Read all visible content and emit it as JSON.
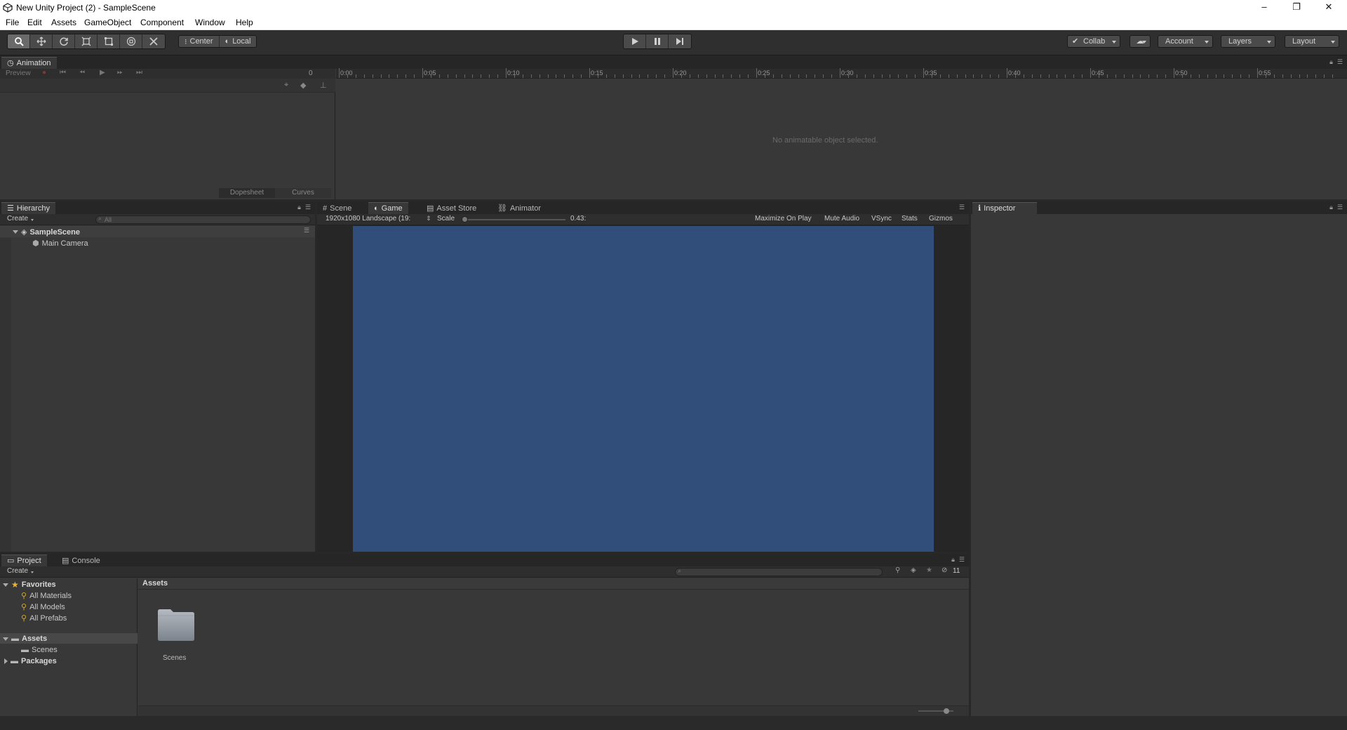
{
  "window": {
    "title": "New Unity Project (2) - SampleScene",
    "controls": {
      "minimize": "–",
      "maximize": "❐",
      "close": "✕"
    }
  },
  "menu": [
    "File",
    "Edit",
    "Assets",
    "GameObject",
    "Component",
    "Window",
    "Help"
  ],
  "toolbar": {
    "pivot_label": "Center",
    "space_label": "Local",
    "collab_label": "Collab",
    "account_label": "Account",
    "layers_label": "Layers",
    "layout_label": "Layout"
  },
  "animation": {
    "tab_label": "Animation",
    "preview_label": "Preview",
    "frame_value": "0",
    "time_labels": [
      "0:00",
      "0:05",
      "0:10",
      "0:15",
      "0:20",
      "0:25",
      "0:30",
      "0:35",
      "0:40",
      "0:45",
      "0:50",
      "0:55"
    ],
    "empty_message": "No animatable object selected.",
    "dopesheet_label": "Dopesheet",
    "curves_label": "Curves"
  },
  "hierarchy": {
    "tab_label": "Hierarchy",
    "create_label": "Create",
    "search_placeholder": "All",
    "scene_name": "SampleScene",
    "objects": [
      "Main Camera"
    ]
  },
  "game_view": {
    "tabs": [
      "Scene",
      "Game",
      "Asset Store",
      "Animator"
    ],
    "resolution": "1920x1080 Landscape (19:",
    "scale_label": "Scale",
    "scale_value": "0.43:",
    "maximize_label": "Maximize On Play",
    "mute_label": "Mute Audio",
    "vsync_label": "VSync",
    "stats_label": "Stats",
    "gizmos_label": "Gizmos",
    "background_color": "#314D79"
  },
  "inspector": {
    "tab_label": "Inspector"
  },
  "project": {
    "tabs": [
      "Project",
      "Console"
    ],
    "create_label": "Create",
    "hidden_count": "11",
    "favorites_label": "Favorites",
    "favorites": [
      "All Materials",
      "All Models",
      "All Prefabs"
    ],
    "assets_label": "Assets",
    "asset_children": [
      "Scenes"
    ],
    "packages_label": "Packages",
    "breadcrumb": "Assets",
    "grid_items": [
      "Scenes"
    ]
  }
}
